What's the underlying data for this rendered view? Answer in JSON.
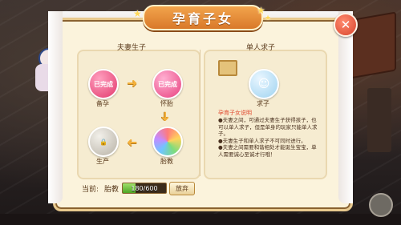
{
  "title": "孕育子女",
  "close_icon": "close-icon",
  "left_panel": {
    "title": "夫妻生子",
    "nodes": [
      {
        "label": "备孕",
        "badge": "已完成",
        "icon": "pregnancy-prep-icon"
      },
      {
        "label": "怀胎",
        "badge": "已完成",
        "icon": "pregnancy-icon"
      },
      {
        "label": "胎教",
        "badge": "",
        "icon": "prenatal-education-icon"
      },
      {
        "label": "生产",
        "badge": "",
        "icon": "lock-icon"
      }
    ]
  },
  "right_panel": {
    "title": "单人求子",
    "node": {
      "label": "求子",
      "icon": "baby-icon"
    },
    "info_title": "孕育子女说明",
    "info_lines": [
      "●夫妻之间，可通过夫妻生子获得孩子，也可以单人求子，但是单身的玩家只能单人求子。",
      "●夫妻生子和单人求子不可同时进行。",
      "●夫妻之间需要和谐相处才能诞生宝宝，单人需要诚心至诚才行哦！"
    ]
  },
  "footer": {
    "current_label": "当前:",
    "current_stage": "胎教",
    "progress_text": "180/600",
    "progress_fraction": 0.3,
    "giveup_label": "放弃"
  },
  "colors": {
    "accent": "#f2a44c",
    "progress": "#4ea626",
    "info_title": "#e0482e"
  }
}
